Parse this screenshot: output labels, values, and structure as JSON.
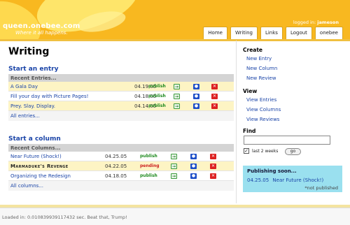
{
  "header": {
    "site_title": "queen.onebee.com",
    "tagline": "Where it all happens.",
    "logged_in_prefix": "logged in:",
    "username": "jameson",
    "nav": [
      "Home",
      "Writing",
      "Links",
      "Logout",
      "onebee"
    ]
  },
  "page_title": "Writing",
  "entries": {
    "title": "Start an entry",
    "subheader": "Recent Entries...",
    "rows": [
      {
        "title": "A Gala Day",
        "date": "04.19.05",
        "status": "publish",
        "highlight": true
      },
      {
        "title": "Fill your day with Picture Pages!",
        "date": "04.18.05",
        "status": "publish",
        "highlight": false
      },
      {
        "title": "Prey. Slay. Display.",
        "date": "04.14.05",
        "status": "publish",
        "highlight": true
      }
    ],
    "all_link": "All entries..."
  },
  "columns": {
    "title": "Start a column",
    "subheader": "Recent Columns...",
    "rows": [
      {
        "title": "Near Future (Shock!)",
        "date": "04.25.05",
        "status": "publish",
        "highlight": false
      },
      {
        "title": "Marmaduke's Revenge",
        "date": "04.22.05",
        "status": "pending",
        "highlight": true
      },
      {
        "title": "Organizing the Redesign",
        "date": "04.18.05",
        "status": "publish",
        "highlight": false
      }
    ],
    "all_link": "All columns..."
  },
  "sidebar": {
    "create_heading": "Create",
    "create_links": [
      "New Entry",
      "New Column",
      "New Review"
    ],
    "view_heading": "View",
    "view_links": [
      "View Entries",
      "View Columns",
      "View Reviews"
    ],
    "find_heading": "Find",
    "find_value": "",
    "last_2_weeks_label": "last 2 weeks",
    "last_2_weeks_checked": true,
    "go_label": "go",
    "publishing_soon": {
      "title": "Publishing soon...",
      "date": "04.25.05",
      "item": "Near Future (Shock!)",
      "note": "*not published"
    }
  },
  "footer": {
    "text": "Loaded in: 0.010839939117432 sec. Beat that, Trump!"
  },
  "colors": {
    "header": "#f8b820",
    "link": "#1b45a8",
    "publish": "#1e8a1e",
    "pending": "#cc2020",
    "highlight_row": "#fdf4c4",
    "publishing_box": "#9ae0ef"
  },
  "icons": [
    "arrow-go-icon",
    "magnifier-view-icon",
    "delete-x-icon"
  ]
}
